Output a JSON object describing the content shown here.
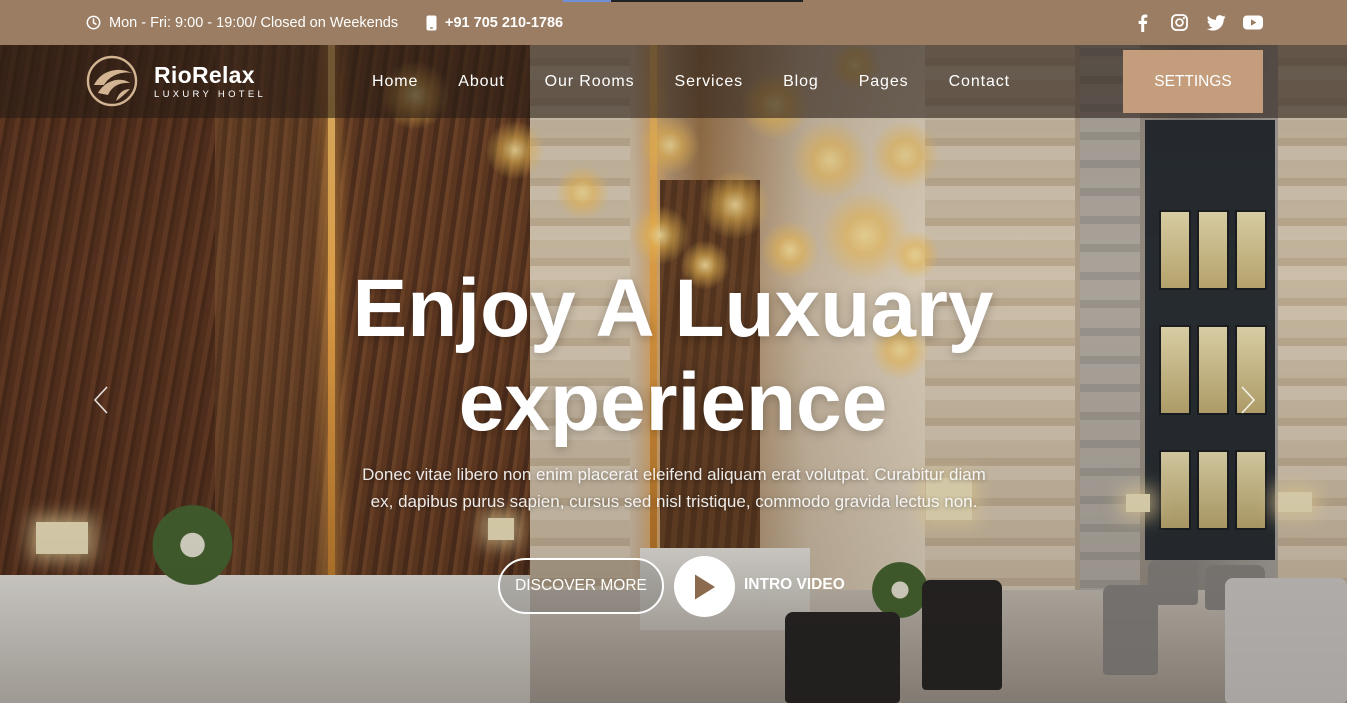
{
  "topbar": {
    "hours": "Mon - Fri: 9:00 - 19:00/ Closed on Weekends",
    "phone": "+91 705 210-1786",
    "socials": [
      "facebook-icon",
      "instagram-icon",
      "twitter-icon",
      "youtube-icon"
    ]
  },
  "brand": {
    "name": "RioRelax",
    "tagline": "LUXURY HOTEL"
  },
  "nav": {
    "items": [
      "Home",
      "About",
      "Our Rooms",
      "Services",
      "Blog",
      "Pages",
      "Contact"
    ],
    "settings_label": "SETTINGS"
  },
  "hero": {
    "title_line1": "Enjoy A Luxuary",
    "title_line2": "experience",
    "description": "Donec vitae libero non enim placerat eleifend aliquam erat volutpat. Curabitur diam ex, dapibus purus sapien, cursus sed nisl tristique, commodo gravida lectus non.",
    "discover_label": "DISCOVER MORE",
    "intro_label": "INTRO VIDEO"
  },
  "colors": {
    "topbar": "#9a7d62",
    "accent": "#c39d7c",
    "nav_overlay": "rgba(40,28,20,0.58)"
  }
}
